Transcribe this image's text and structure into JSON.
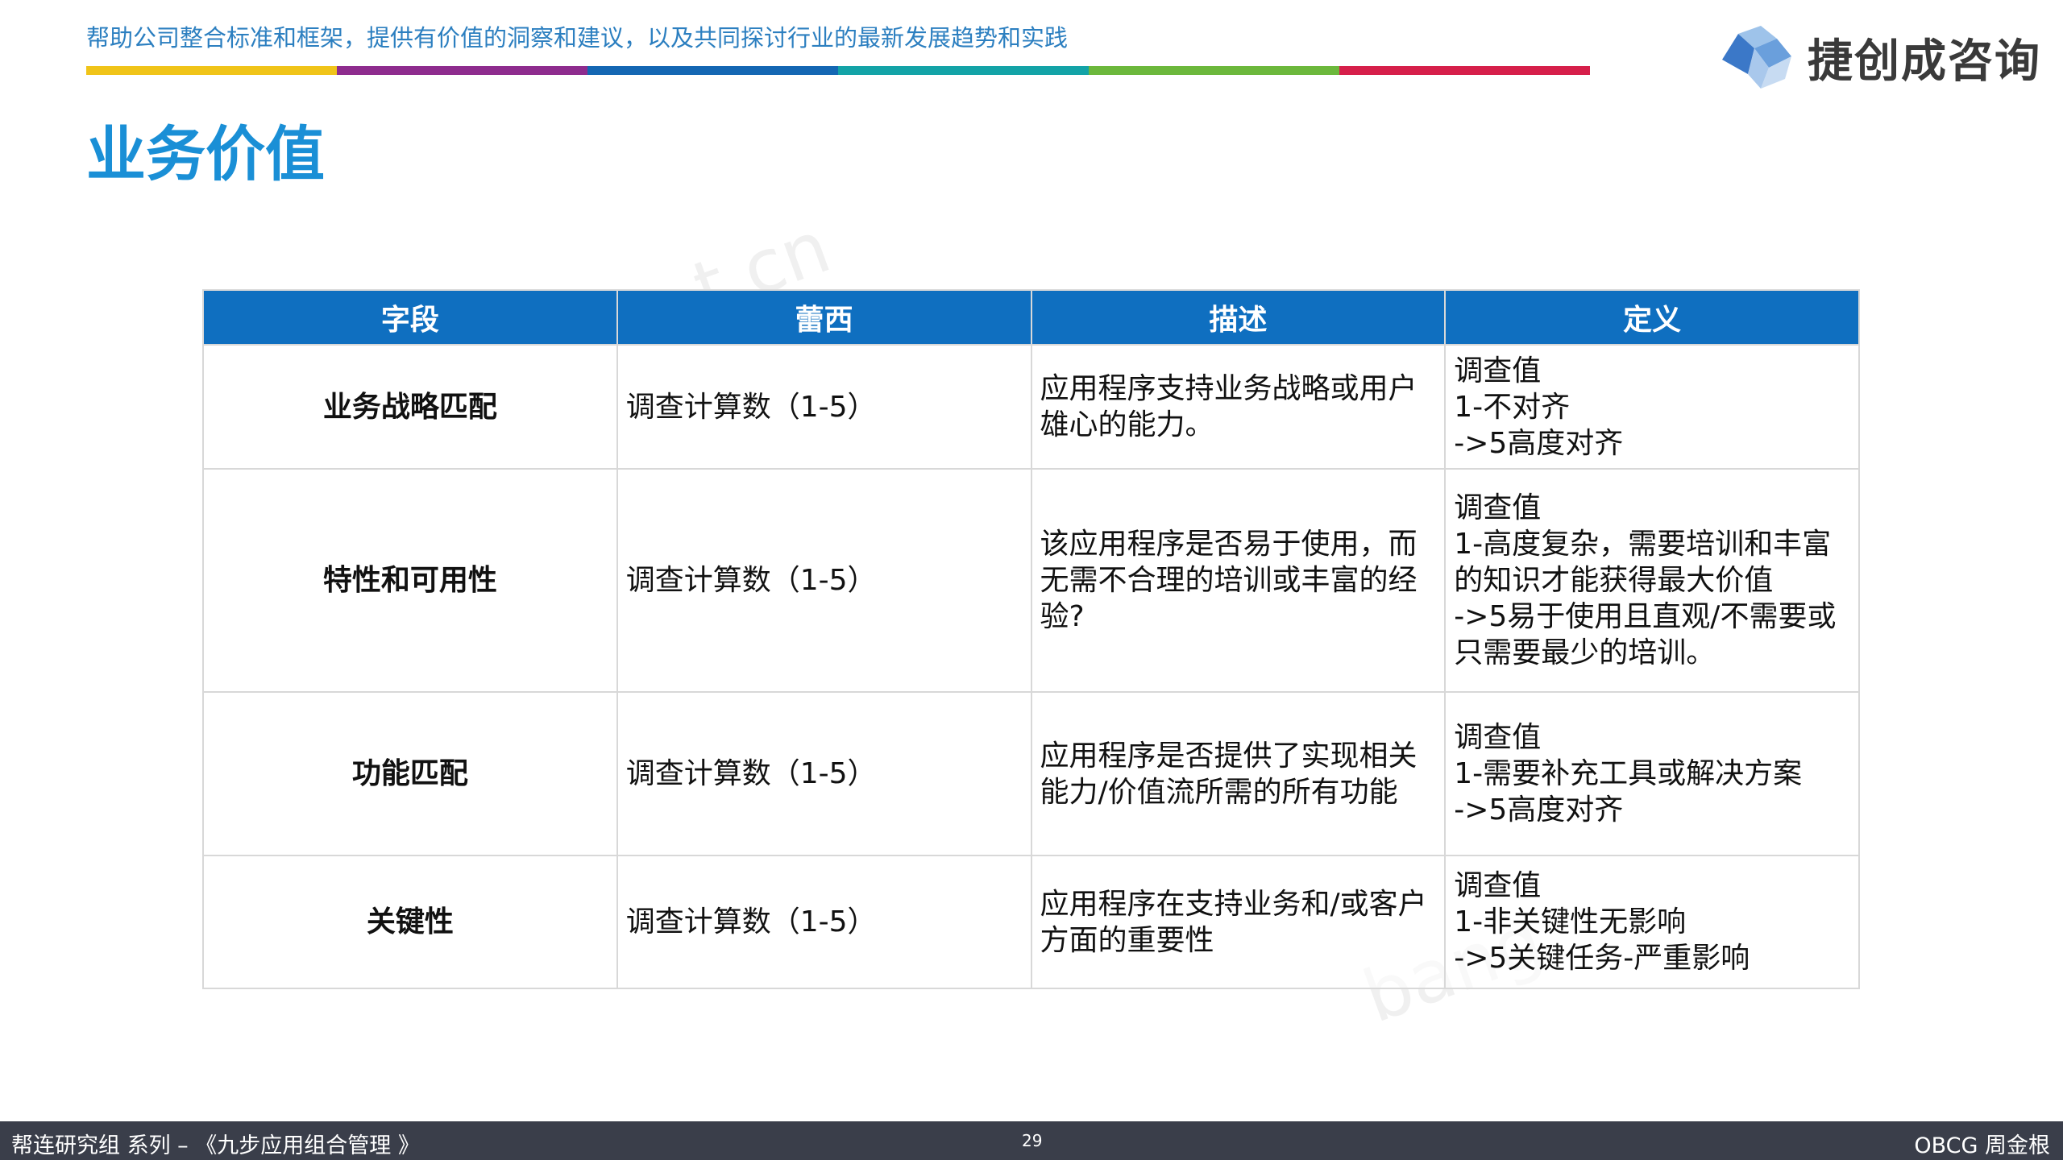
{
  "header": {
    "tagline": "帮助公司整合标准和框架，提供有价值的洞察和建议，以及共同探讨行业的最新发展趋势和实践",
    "logo_text": "捷创成咨询",
    "color_bar": [
      "#f0c419",
      "#8e2c8e",
      "#1467b3",
      "#13a3a7",
      "#6cb83c",
      "#d61f4a"
    ]
  },
  "title": "业务价值",
  "watermarks": [
    "t.cn",
    "bang"
  ],
  "table": {
    "headers": [
      "字段",
      "蕾西",
      "描述",
      "定义"
    ],
    "rows": [
      {
        "field": "业务战略匹配",
        "leixi": "调查计算数（1-5）",
        "desc": "应用程序支持业务战略或用户雄心的能力。",
        "def": "调查值\n1-不对齐\n->5高度对齐"
      },
      {
        "field": "特性和可用性",
        "leixi": "调查计算数（1-5）",
        "desc": "该应用程序是否易于使用，而无需不合理的培训或丰富的经验?",
        "def": "调查值\n1-高度复杂，需要培训和丰富的知识才能获得最大价值\n->5易于使用且直观/不需要或只需要最少的培训。"
      },
      {
        "field": "功能匹配",
        "leixi": "调查计算数（1-5）",
        "desc": "应用程序是否提供了实现相关能力/价值流所需的所有功能",
        "def": "调查值\n1-需要补充工具或解决方案\n->5高度对齐"
      },
      {
        "field": "关键性",
        "leixi": "调查计算数（1-5）",
        "desc": "应用程序在支持业务和/或客户方面的重要性",
        "def": "调查值\n1-非关键性无影响\n->5关键任务-严重影响"
      }
    ]
  },
  "footer": {
    "left": "帮连研究组 系列 – 《九步应用组合管理 》",
    "page_number": "29",
    "right": "OBCG 周金根"
  }
}
